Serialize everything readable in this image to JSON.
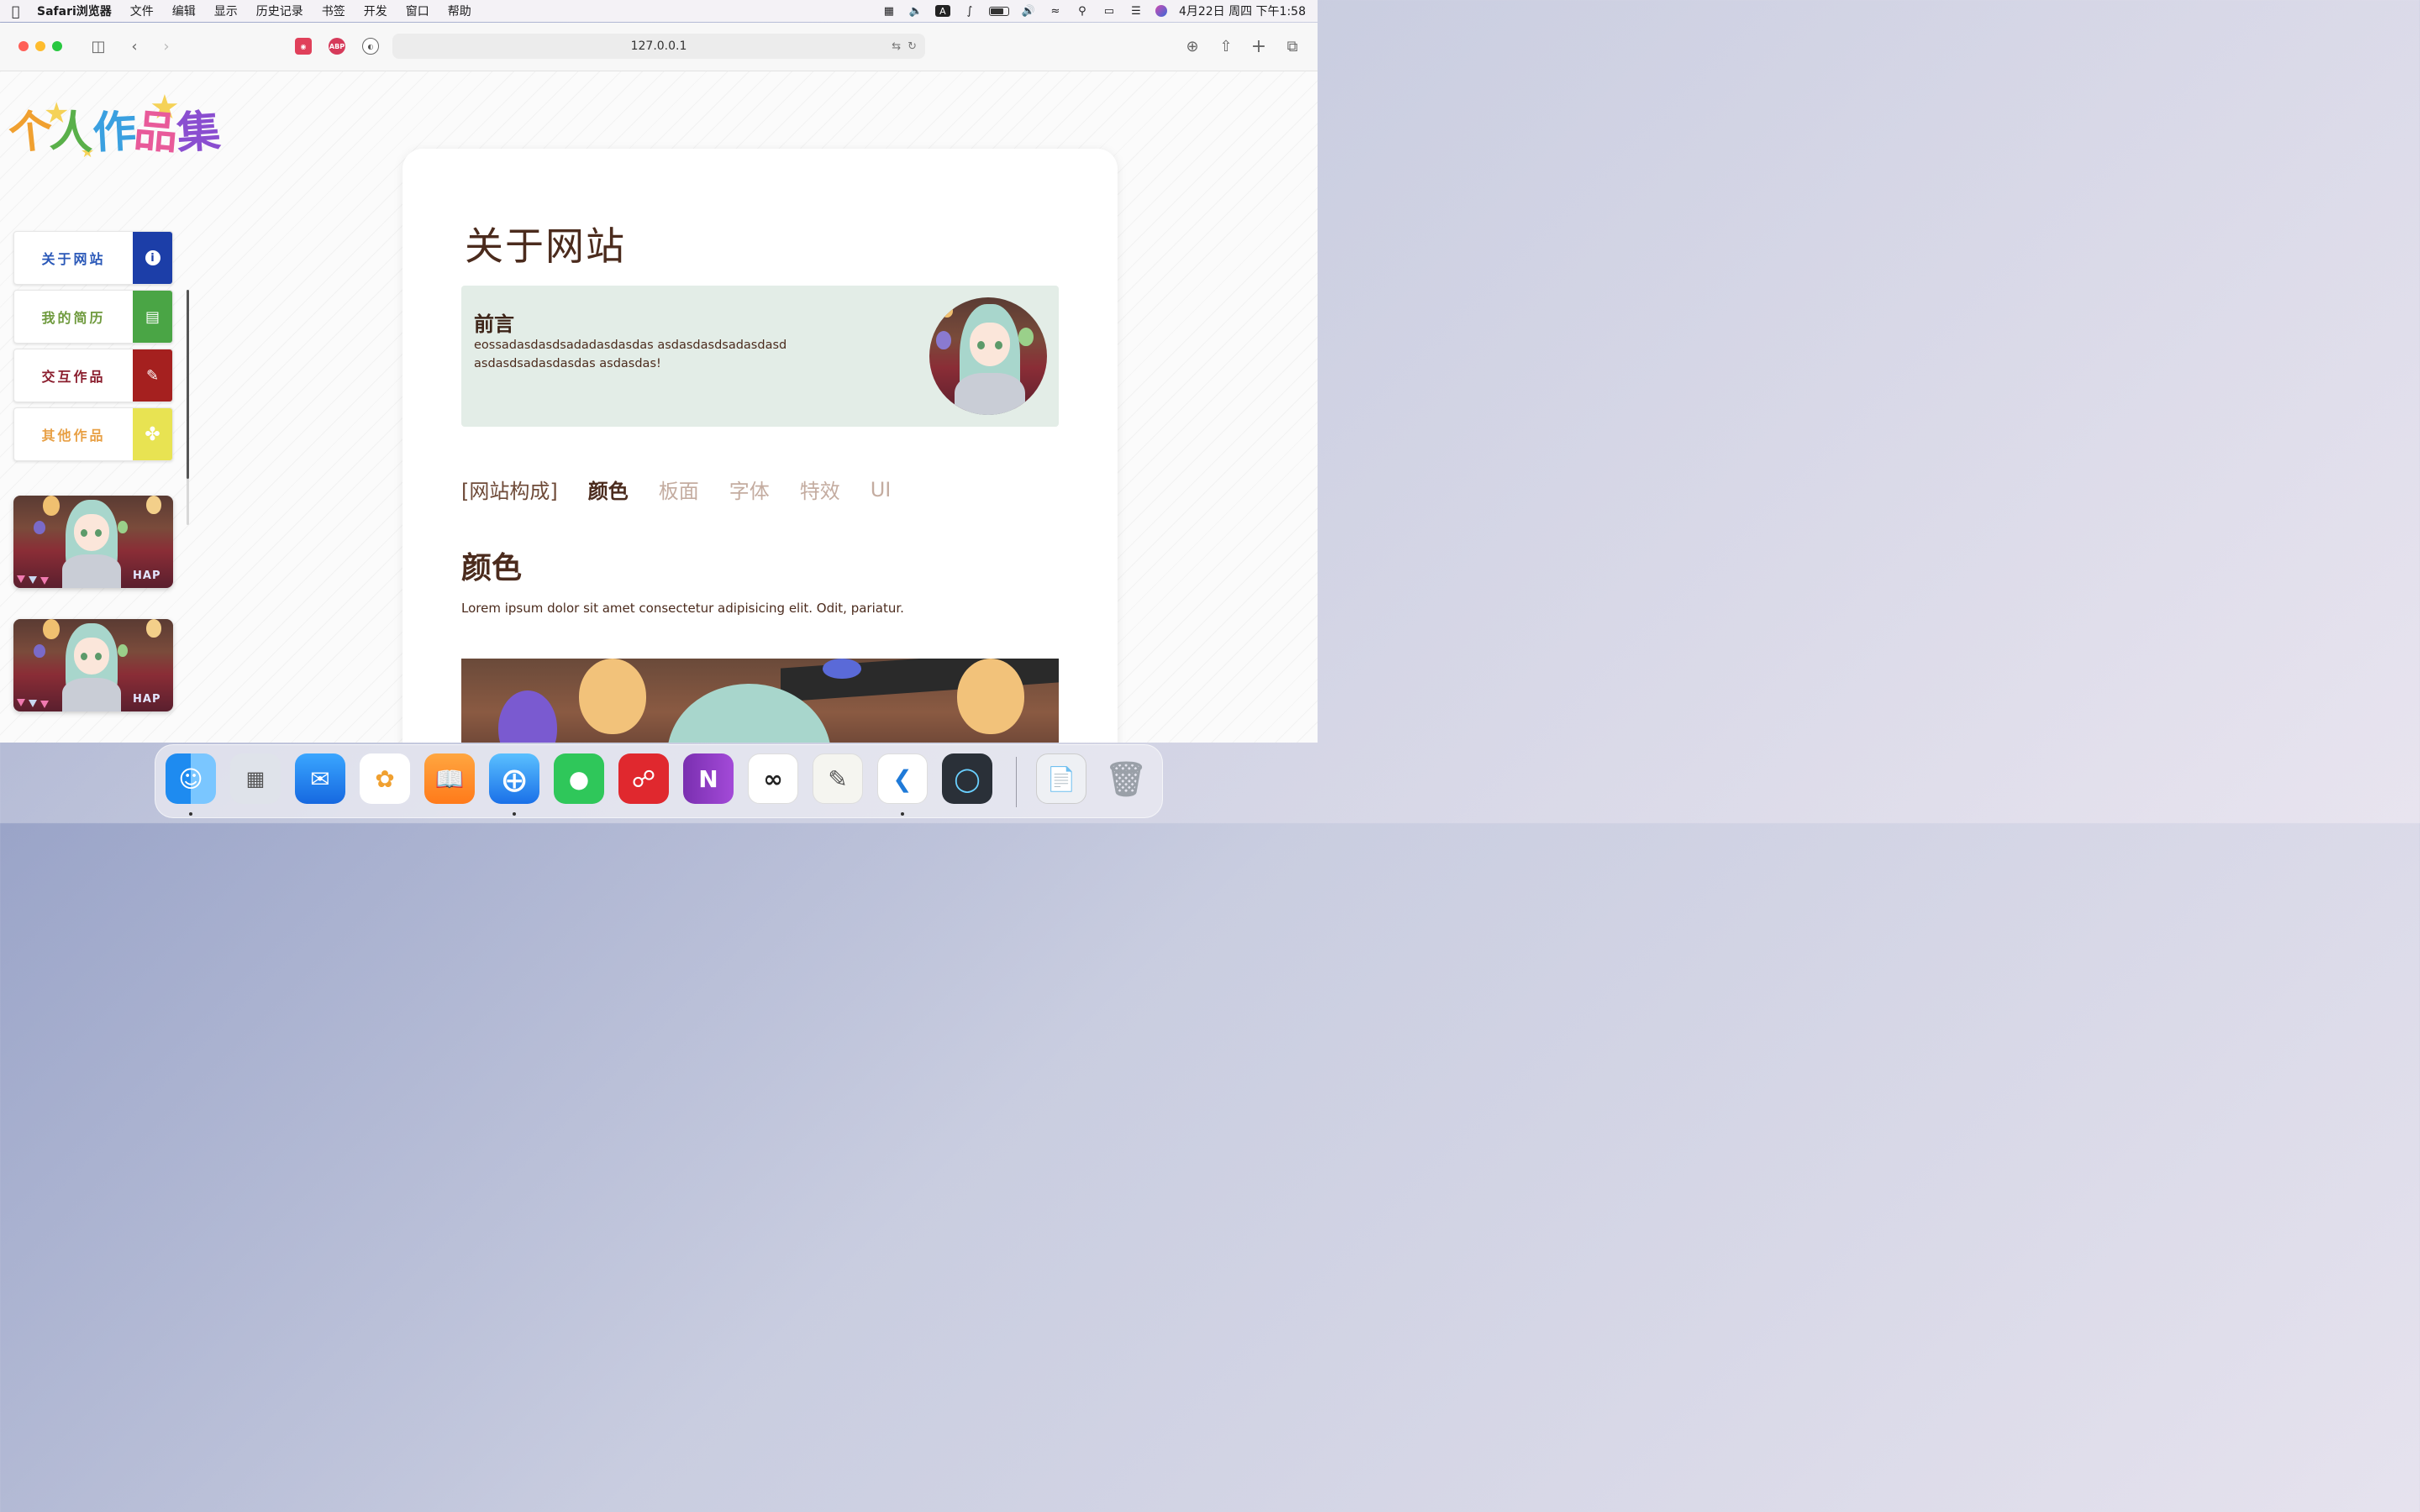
{
  "menubar": {
    "app_name": "Safari浏览器",
    "menus": [
      "文件",
      "编辑",
      "显示",
      "历史记录",
      "书签",
      "开发",
      "窗口",
      "帮助"
    ],
    "clock": "4月22日 周四 下午1:58",
    "input_method": "A"
  },
  "browser": {
    "url": "127.0.0.1",
    "extensions": [
      "ABP"
    ]
  },
  "site": {
    "logo": [
      "个",
      "人",
      "作",
      "品",
      "集"
    ],
    "nav": [
      {
        "label": "关于网站",
        "icon": "info-icon",
        "text_color": "#2a58b8",
        "icon_bg": "#1c3ea8",
        "glyph": "i"
      },
      {
        "label": "我的简历",
        "icon": "document-icon",
        "text_color": "#6f9a3e",
        "icon_bg": "#4aa545",
        "glyph": "▤"
      },
      {
        "label": "交互作品",
        "icon": "tools-icon",
        "text_color": "#8b1e2e",
        "icon_bg": "#a5201f",
        "glyph": "✎"
      },
      {
        "label": "其他作品",
        "icon": "grid-icon",
        "text_color": "#e8a045",
        "icon_bg": "#e8e352",
        "glyph": "✤"
      }
    ],
    "thumbs_text": "HAP"
  },
  "main": {
    "title": "关于网站",
    "intro": {
      "title": "前言",
      "text": "eossadasdasdsadadasdasdas asdasdasdsadasdasd asdasdsadasdasdas asdasdas!"
    },
    "tabs": {
      "heading": "[网站构成]",
      "items": [
        "颜色",
        "板面",
        "字体",
        "特效",
        "UI"
      ],
      "active": "颜色"
    },
    "section": {
      "title": "颜色",
      "text": "Lorem ipsum dolor sit amet consectetur adipisicing elit. Odit, pariatur."
    }
  },
  "dock": {
    "apps": [
      "finder-icon",
      "launchpad-icon",
      "mail-icon",
      "photos-icon",
      "books-icon",
      "safari-icon",
      "wechat-icon",
      "netease-music-icon",
      "onenote-icon",
      "clip-studio-icon",
      "textedit-icon",
      "vscode-icon",
      "quicktime-icon",
      "file-icon",
      "trash-icon"
    ],
    "onenote_letter": "N"
  }
}
